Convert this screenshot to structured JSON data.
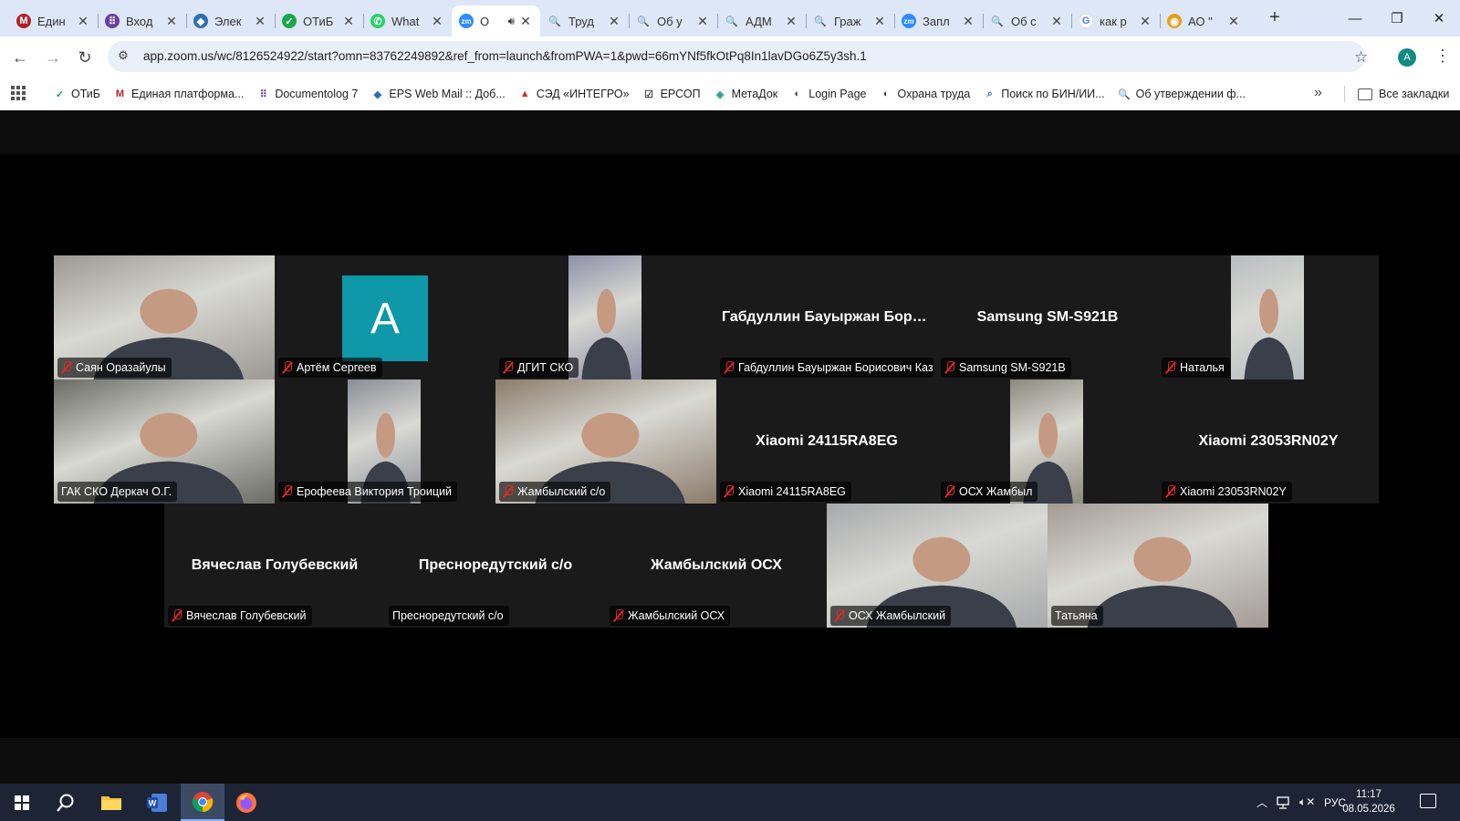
{
  "browser": {
    "tabs": [
      {
        "title": "Един",
        "icon": "lms-icon",
        "color": "#b1222a",
        "glyph": "M",
        "active": false,
        "speaker": false
      },
      {
        "title": "Вход",
        "icon": "documentolog-icon",
        "color": "#6b3fa0",
        "glyph": "⠿",
        "active": false,
        "speaker": false
      },
      {
        "title": "Элек",
        "icon": "cube-icon",
        "color": "#2c6fb5",
        "glyph": "◆",
        "active": false,
        "speaker": false
      },
      {
        "title": "ОТиБ",
        "icon": "shield-icon",
        "color": "#1aa64b",
        "glyph": "✓",
        "active": false,
        "speaker": false
      },
      {
        "title": "What",
        "icon": "whatsapp-icon",
        "color": "#25d366",
        "glyph": "✆",
        "active": false,
        "speaker": false
      },
      {
        "title": "О",
        "icon": "zoom-icon",
        "color": "#2d8cff",
        "glyph": "zm",
        "active": true,
        "speaker": true
      },
      {
        "title": "Труд",
        "icon": "search-icon",
        "color": "#c0392b",
        "glyph": "🔍",
        "active": false,
        "speaker": false
      },
      {
        "title": "Об у",
        "icon": "search-icon",
        "color": "#c0392b",
        "glyph": "🔍",
        "active": false,
        "speaker": false
      },
      {
        "title": "АДМ",
        "icon": "search-icon",
        "color": "#c0392b",
        "glyph": "🔍",
        "active": false,
        "speaker": false
      },
      {
        "title": "Граж",
        "icon": "search-icon",
        "color": "#c0392b",
        "glyph": "🔍",
        "active": false,
        "speaker": false
      },
      {
        "title": "Запл",
        "icon": "zoom-icon",
        "color": "#2d8cff",
        "glyph": "zm",
        "active": false,
        "speaker": false
      },
      {
        "title": "Об с",
        "icon": "search-icon",
        "color": "#c0392b",
        "glyph": "🔍",
        "active": false,
        "speaker": false
      },
      {
        "title": "как р",
        "icon": "google-icon",
        "color": "#4285f4",
        "glyph": "G",
        "active": false,
        "speaker": false
      },
      {
        "title": "АО \"",
        "icon": "company-icon",
        "color": "#e9a019",
        "glyph": "◉",
        "active": false,
        "speaker": false
      }
    ],
    "new_tab": "+",
    "window_controls": {
      "minimize": "—",
      "restore": "❐",
      "close": "✕"
    },
    "url": "app.zoom.us/wc/8126524922/start?omn=83762249892&ref_from=launch&fromPWA=1&pwd=66mYNf5fkOtPq8In1lavDGo6Z5y3sh.1",
    "profile_initial": "A",
    "bookmarks": [
      {
        "label": "ОТиБ",
        "icon": "shield-icon",
        "color": "#1aa64b",
        "glyph": "✓"
      },
      {
        "label": "Единая платформа...",
        "icon": "lms-icon",
        "color": "#b1222a",
        "glyph": "M"
      },
      {
        "label": "Documentolog 7",
        "icon": "documentolog-icon",
        "color": "#6b3fa0",
        "glyph": "⠿"
      },
      {
        "label": "EPS Web Mail :: Доб...",
        "icon": "cube-icon",
        "color": "#2c6fb5",
        "glyph": "◆"
      },
      {
        "label": "СЭД «ИНТЕГРО»",
        "icon": "integro-icon",
        "color": "#c0392b",
        "glyph": "▲"
      },
      {
        "label": "ЕРСОП",
        "icon": "document-icon",
        "color": "#444444",
        "glyph": "☑"
      },
      {
        "label": "МетаДок",
        "icon": "metadoc-icon",
        "color": "#2a9d8f",
        "glyph": "◈"
      },
      {
        "label": "Login Page",
        "icon": "globe-icon",
        "color": "#444444",
        "glyph": "◐"
      },
      {
        "label": "Охрана труда",
        "icon": "globe-icon",
        "color": "#444444",
        "glyph": "◐"
      },
      {
        "label": "Поиск по БИН/ИИ...",
        "icon": "search-doc-icon",
        "color": "#2c6fb5",
        "glyph": "⌕"
      },
      {
        "label": "Об утверждении ф...",
        "icon": "search-icon",
        "color": "#c0392b",
        "glyph": "🔍"
      }
    ],
    "all_bookmarks": "Все закладки"
  },
  "meeting": {
    "tiles": [
      {
        "name": "Саян Оразайулы",
        "big": "",
        "muted": true,
        "video": true,
        "bg": "#9a9893",
        "col": 0,
        "row": 0,
        "span": 1
      },
      {
        "name": "Артём Сергеев",
        "big": "",
        "muted": true,
        "video": false,
        "avatar": "A",
        "bg": "#1a1a1a",
        "col": 1,
        "row": 0,
        "span": 1
      },
      {
        "name": "ДГИТ СКО",
        "big": "",
        "muted": true,
        "video": true,
        "bg": "#8e8fa8",
        "narrow": true,
        "col": 2,
        "row": 0,
        "span": 1
      },
      {
        "name": "Габдуллин Бауыржан Борисович Каз...",
        "big": "Габдуллин Бауыржан Бори...",
        "muted": true,
        "video": false,
        "bg": "#1a1a1a",
        "col": 3,
        "row": 0,
        "span": 1
      },
      {
        "name": "Samsung SM-S921B",
        "big": "Samsung SM-S921B",
        "muted": true,
        "video": false,
        "bg": "#1a1a1a",
        "col": 4,
        "row": 0,
        "span": 1
      },
      {
        "name": "Наталья",
        "big": "",
        "muted": true,
        "video": true,
        "bg": "#b8bec0",
        "narrow": true,
        "col": 5,
        "row": 0,
        "span": 1
      },
      {
        "name": "ГАК СКО Деркач О.Г.",
        "big": "",
        "muted": false,
        "video": true,
        "bg": "#6b6b66",
        "active": true,
        "col": 0,
        "row": 1,
        "span": 1
      },
      {
        "name": "Ерофеева Виктория Троиций",
        "big": "",
        "muted": true,
        "video": true,
        "bg": "#8a8d96",
        "narrow": true,
        "col": 1,
        "row": 1,
        "span": 1
      },
      {
        "name": "Жамбылский с/о",
        "big": "",
        "muted": true,
        "video": true,
        "bg": "#8b7c6a",
        "col": 2,
        "row": 1,
        "span": 1
      },
      {
        "name": "Xiaomi 24115RA8EG",
        "big": "Xiaomi 24115RA8EG",
        "muted": true,
        "video": false,
        "bg": "#1a1a1a",
        "col": 3,
        "row": 1,
        "span": 1
      },
      {
        "name": "ОСХ Жамбыл",
        "big": "",
        "muted": true,
        "video": true,
        "bg": "#8c8a7e",
        "narrow": true,
        "col": 4,
        "row": 1,
        "span": 1
      },
      {
        "name": "Xiaomi 23053RN02Y",
        "big": "Xiaomi 23053RN02Y",
        "muted": true,
        "video": false,
        "bg": "#1a1a1a",
        "col": 5,
        "row": 1,
        "span": 1
      },
      {
        "name": "Вячеслав Голубевский",
        "big": "Вячеслав Голубевский",
        "muted": true,
        "video": false,
        "bg": "#1a1a1a",
        "col": 0.5,
        "row": 2,
        "span": 1
      },
      {
        "name": "Преснoредутский с/о",
        "big": "Преснoредутский с/о",
        "muted": false,
        "video": false,
        "bg": "#1a1a1a",
        "col": 1.5,
        "row": 2,
        "span": 1
      },
      {
        "name": "Жамбылский ОСХ",
        "big": "Жамбылский ОСХ",
        "muted": true,
        "video": false,
        "bg": "#1a1a1a",
        "col": 2.5,
        "row": 2,
        "span": 1
      },
      {
        "name": "ОСХ Жамбылский",
        "big": "",
        "muted": true,
        "video": true,
        "bg": "#a7a9ab",
        "col": 3.5,
        "row": 2,
        "span": 1
      },
      {
        "name": "Татьяна",
        "big": "",
        "muted": false,
        "video": true,
        "bg": "#a49a94",
        "col": 4.5,
        "row": 2,
        "span": 1
      }
    ]
  },
  "taskbar": {
    "apps": [
      {
        "name": "start-button",
        "icon": "windows-icon"
      },
      {
        "name": "search-button",
        "icon": "search-icon"
      },
      {
        "name": "file-explorer-button",
        "icon": "folder-icon"
      },
      {
        "name": "word-button",
        "icon": "word-icon"
      },
      {
        "name": "chrome-button",
        "icon": "chrome-icon"
      },
      {
        "name": "firefox-button",
        "icon": "firefox-icon"
      }
    ],
    "language": "РУС",
    "time": "11:17",
    "date": "08.05.2026"
  }
}
